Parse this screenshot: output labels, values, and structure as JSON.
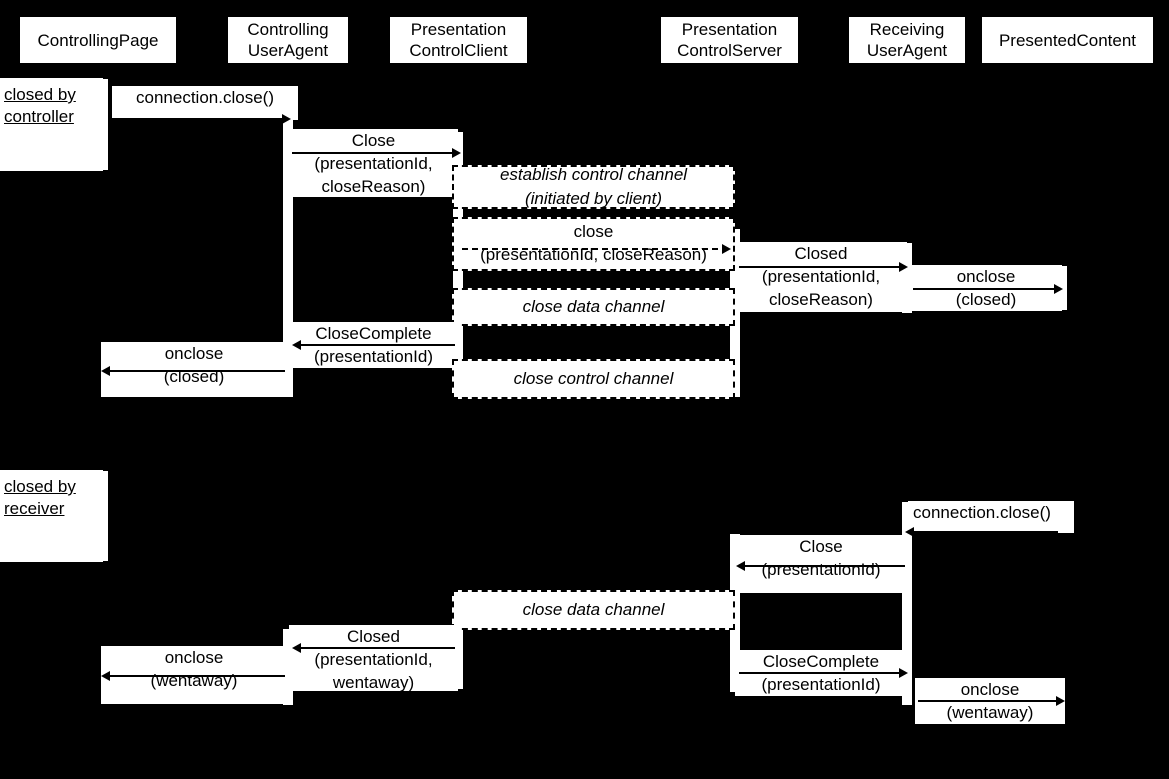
{
  "diagram": {
    "title": "Presentation API connection close sequence",
    "background_color": "#000000",
    "box_fill_color": "#ffffff",
    "line_color": "#000000"
  },
  "lifelines": [
    {
      "name": "ControllingPage",
      "label": "ControllingPage"
    },
    {
      "name": "ControllingUserAgent",
      "label": "Controlling\nUserAgent"
    },
    {
      "name": "PresentationControlClient",
      "label": "Presentation\nControlClient"
    },
    {
      "name": "PresentationControlServer",
      "label": "Presentation\nControlServer"
    },
    {
      "name": "ReceivingUserAgent",
      "label": "Receiving\nUserAgent"
    },
    {
      "name": "PresentedContent",
      "label": "PresentedContent"
    }
  ],
  "scenarios": [
    {
      "id": "closed-by-controller",
      "note": "closed by\ncontroller",
      "note_line1": "closed by",
      "note_line2": "controller"
    },
    {
      "id": "closed-by-receiver",
      "note": "closed by\nreceiver",
      "note_line1": "closed by",
      "note_line2": "receiver"
    }
  ],
  "messages": [
    {
      "id": "m1",
      "label": "connection.close()",
      "sublabel": "",
      "from": "ControllingPage",
      "to": "ControllingUserAgent",
      "style": "solid",
      "direction": "right"
    },
    {
      "id": "m2",
      "label": "Close",
      "sublabel": "(presentationId,\ncloseReason)",
      "from": "ControllingUserAgent",
      "to": "PresentationControlClient",
      "style": "solid",
      "direction": "right"
    },
    {
      "id": "m3",
      "label": "establish control channel\n(initiated by client)",
      "sublabel": "",
      "from": "PresentationControlClient",
      "to": "PresentationControlServer",
      "style": "dashed-note",
      "direction": "none"
    },
    {
      "id": "m4",
      "label": "close",
      "sublabel": "(presentationId, closeReason)",
      "from": "PresentationControlClient",
      "to": "PresentationControlServer",
      "style": "dashed",
      "direction": "right"
    },
    {
      "id": "m5",
      "label": "Closed",
      "sublabel": "(presentationId,\ncloseReason)",
      "from": "PresentationControlServer",
      "to": "ReceivingUserAgent",
      "style": "solid",
      "direction": "right"
    },
    {
      "id": "m6",
      "label": "onclose",
      "sublabel": "(closed)",
      "from": "ReceivingUserAgent",
      "to": "PresentedContent",
      "style": "solid",
      "direction": "right"
    },
    {
      "id": "m7",
      "label": "close data channel",
      "sublabel": "",
      "from": "PresentationControlClient",
      "to": "PresentationControlServer",
      "style": "dashed-note",
      "direction": "none"
    },
    {
      "id": "m8",
      "label": "CloseComplete",
      "sublabel": "(presentationId)",
      "from": "PresentationControlClient",
      "to": "ControllingUserAgent",
      "style": "solid",
      "direction": "left"
    },
    {
      "id": "m9",
      "label": "onclose",
      "sublabel": "(closed)",
      "from": "ControllingUserAgent",
      "to": "ControllingPage",
      "style": "solid",
      "direction": "left"
    },
    {
      "id": "m10",
      "label": "close control channel",
      "sublabel": "",
      "from": "PresentationControlClient",
      "to": "PresentationControlServer",
      "style": "dashed-note",
      "direction": "none"
    },
    {
      "id": "m11",
      "label": "connection.close()",
      "sublabel": "",
      "from": "PresentedContent",
      "to": "ReceivingUserAgent",
      "style": "solid",
      "direction": "left"
    },
    {
      "id": "m12",
      "label": "Close",
      "sublabel": "(presentationId)",
      "from": "ReceivingUserAgent",
      "to": "PresentationControlServer",
      "style": "solid",
      "direction": "left"
    },
    {
      "id": "m13",
      "label": "close data channel",
      "sublabel": "",
      "from": "PresentationControlServer",
      "to": "PresentationControlClient",
      "style": "dashed-note",
      "direction": "none"
    },
    {
      "id": "m14",
      "label": "Closed",
      "sublabel": "(presentationId,\nwentaway)",
      "from": "PresentationControlClient",
      "to": "ControllingUserAgent",
      "style": "solid",
      "direction": "left"
    },
    {
      "id": "m15",
      "label": "onclose",
      "sublabel": "(wentaway)",
      "from": "ControllingUserAgent",
      "to": "ControllingPage",
      "style": "solid",
      "direction": "left"
    },
    {
      "id": "m16",
      "label": "CloseComplete",
      "sublabel": "(presentationId)",
      "from": "PresentationControlServer",
      "to": "ReceivingUserAgent",
      "style": "solid",
      "direction": "right"
    },
    {
      "id": "m17",
      "label": "onclose",
      "sublabel": "(wentaway)",
      "from": "ReceivingUserAgent",
      "to": "PresentedContent",
      "style": "solid",
      "direction": "right"
    }
  ]
}
